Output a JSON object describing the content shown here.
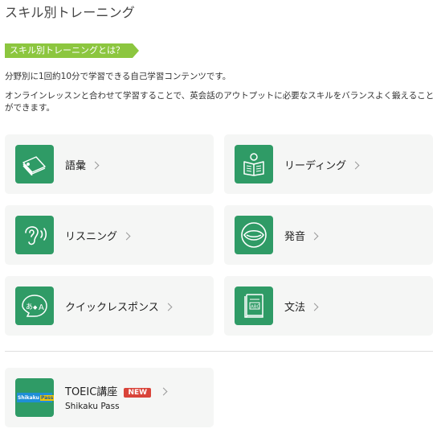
{
  "page": {
    "title": "スキル別トレーニング",
    "tag": "スキル別トレーニングとは？",
    "intro1": "分野別に1回約10分で学習できる自己学習コンテンツです。",
    "intro2": "オンラインレッスンと合わせて学習することで、英会話のアウトプットに必要なスキルをバランスよく鍛えることができます。"
  },
  "cards": [
    {
      "label": "語彙",
      "icon": "vocabulary-cards-icon"
    },
    {
      "label": "リーディング",
      "icon": "reading-book-icon"
    },
    {
      "label": "リスニング",
      "icon": "ear-icon"
    },
    {
      "label": "発音",
      "icon": "mouth-icon"
    },
    {
      "label": "クイックレスポンス",
      "icon": "speech-bubble-icon"
    },
    {
      "label": "文法",
      "icon": "grammar-book-icon"
    }
  ],
  "toeic": {
    "title": "TOEIC講座",
    "badge": "NEW",
    "subtitle": "Shikaku Pass",
    "logo_left": "Shikaku",
    "logo_right": "Pass"
  },
  "colors": {
    "icon_bg": "#2f9b66",
    "tag_bg": "#8cc63f",
    "badge_bg": "#d9443a",
    "card_bg": "#f5f6f5"
  }
}
